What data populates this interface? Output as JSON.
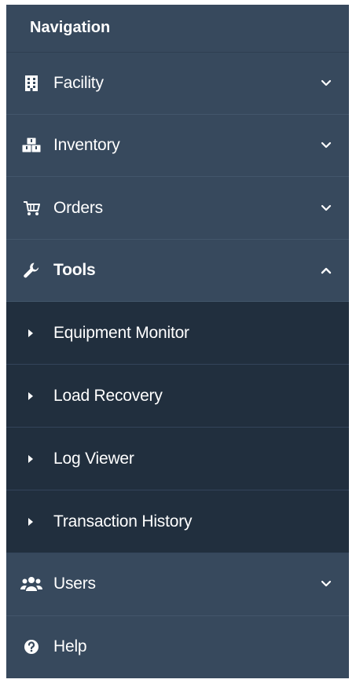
{
  "sidebar": {
    "header": "Navigation",
    "items": [
      {
        "label": "Facility",
        "icon": "building-icon"
      },
      {
        "label": "Inventory",
        "icon": "cubes-icon"
      },
      {
        "label": "Orders",
        "icon": "cart-icon"
      },
      {
        "label": "Tools",
        "icon": "wrench-icon",
        "expanded": true,
        "children": [
          {
            "label": "Equipment Monitor"
          },
          {
            "label": "Load Recovery"
          },
          {
            "label": "Log Viewer"
          },
          {
            "label": "Transaction History"
          }
        ]
      },
      {
        "label": "Users",
        "icon": "users-icon"
      },
      {
        "label": "Help",
        "icon": "question-circle-icon"
      }
    ]
  },
  "colors": {
    "sidebar_bg": "#37495d",
    "submenu_bg": "#212f3e",
    "text": "#ffffff"
  }
}
